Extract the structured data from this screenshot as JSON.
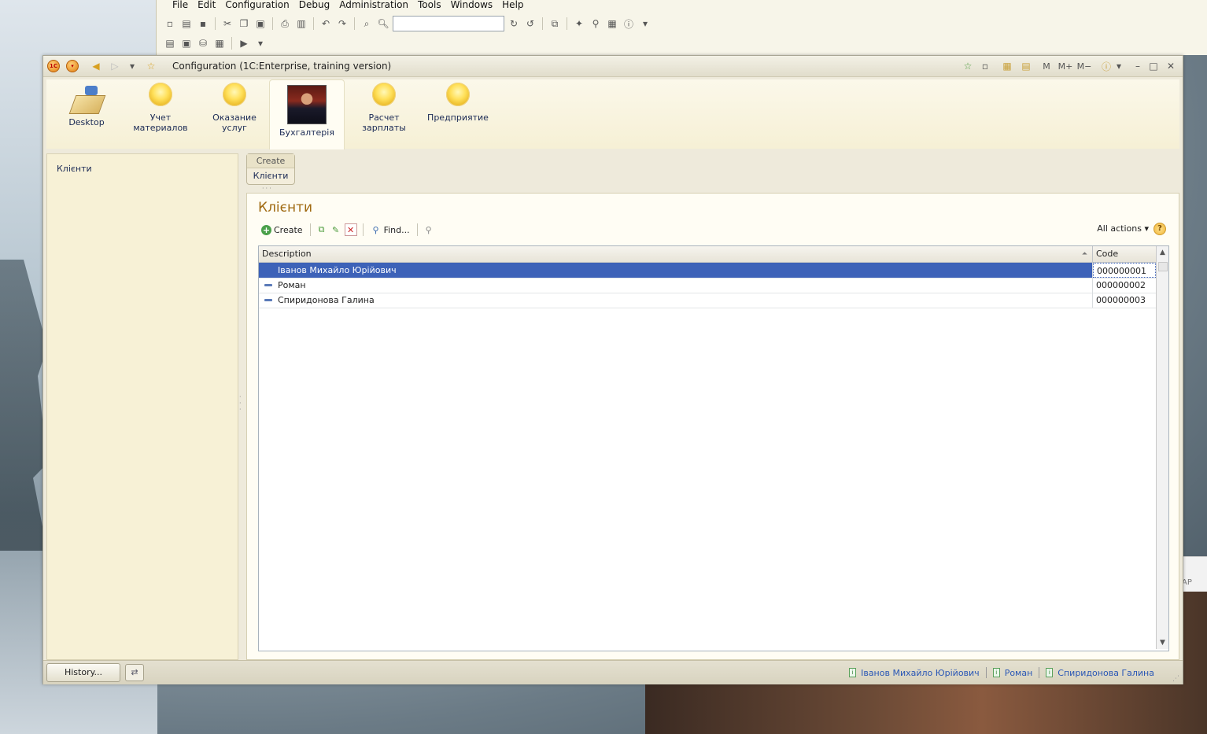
{
  "designer": {
    "menu": [
      "File",
      "Edit",
      "Configuration",
      "Debug",
      "Administration",
      "Tools",
      "Windows",
      "Help"
    ],
    "search_value": ""
  },
  "window": {
    "title": "Configuration  (1C:Enterprise, training version)"
  },
  "sections": [
    {
      "label_line1": "Desktop",
      "label_line2": "",
      "icon": "desktop-icon"
    },
    {
      "label_line1": "Учет",
      "label_line2": "материалов",
      "icon": "ball-icon"
    },
    {
      "label_line1": "Оказание",
      "label_line2": "услуг",
      "icon": "ball-icon"
    },
    {
      "label_line1": "Бухгалтерія",
      "label_line2": "",
      "icon": "photo-icon"
    },
    {
      "label_line1": "Расчет",
      "label_line2": "зарплаты",
      "icon": "ball-icon"
    },
    {
      "label_line1": "Предприятие",
      "label_line2": "",
      "icon": "ball-icon"
    }
  ],
  "nav": {
    "items": [
      "Клієнти"
    ]
  },
  "action_panel": {
    "header": "Create",
    "item": "Клієнти"
  },
  "form": {
    "title": "Клієнти",
    "create_label": "Create",
    "find_label": "Find...",
    "all_actions_label": "All actions",
    "help_label": "?"
  },
  "table": {
    "columns": [
      "Description",
      "Code"
    ],
    "rows": [
      {
        "description": "Іванов Михайло Юрійович",
        "code": "000000001",
        "selected": true
      },
      {
        "description": "Роман",
        "code": "000000002",
        "selected": false
      },
      {
        "description": "Спиридонова Галина",
        "code": "000000003",
        "selected": false
      }
    ]
  },
  "bottom": {
    "history_label": "History...",
    "open_forms": [
      "Іванов Михайло Юрійович",
      "Роман",
      "Спиридонова Галина"
    ]
  },
  "side_panel_text": "AP"
}
